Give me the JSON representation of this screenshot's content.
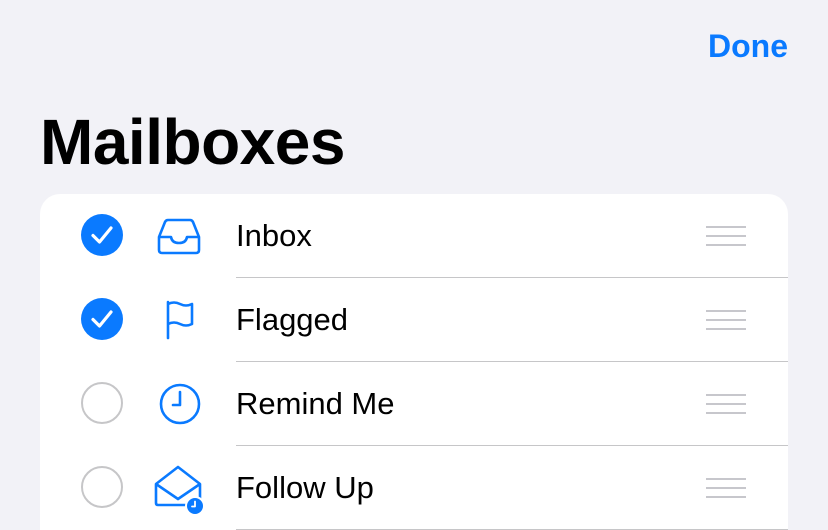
{
  "header": {
    "done_label": "Done",
    "title": "Mailboxes"
  },
  "accent_color": "#0a7aff",
  "mailboxes": [
    {
      "label": "Inbox",
      "checked": true,
      "icon": "inbox-tray-icon"
    },
    {
      "label": "Flagged",
      "checked": true,
      "icon": "flag-icon"
    },
    {
      "label": "Remind Me",
      "checked": false,
      "icon": "clock-icon"
    },
    {
      "label": "Follow Up",
      "checked": false,
      "icon": "envelope-clock-icon"
    }
  ]
}
